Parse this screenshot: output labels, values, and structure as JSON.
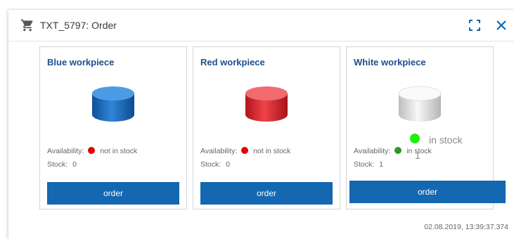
{
  "window": {
    "title": "TXT_5797: Order",
    "icons": {
      "title": "cart-icon",
      "expand": "expand-icon",
      "close": "close-icon"
    }
  },
  "cards": [
    {
      "title": "Blue workpiece",
      "color": "#1f6fbf",
      "availability_label": "Availability:",
      "availability_status": "not in stock",
      "status_color": "#e60000",
      "stock_label": "Stock:",
      "stock_value": "0",
      "order_label": "order"
    },
    {
      "title": "Red workpiece",
      "color": "#dd2428",
      "availability_label": "Availability:",
      "availability_status": "not in stock",
      "status_color": "#e60000",
      "stock_label": "Stock:",
      "stock_value": "0",
      "order_label": "order"
    },
    {
      "title": "White workpiece",
      "color": "#e6e6e6",
      "availability_label": "Availability:",
      "availability_status": "in stock",
      "status_color": "#2a9a2a",
      "stock_label": "Stock:",
      "stock_value": "1",
      "order_label": "order"
    }
  ],
  "overlay": {
    "status_text": "in stock",
    "status_color": "#22ee11",
    "stock_value": "1"
  },
  "footer": {
    "timestamp": "02.08.2019, 13:39:37.374"
  }
}
